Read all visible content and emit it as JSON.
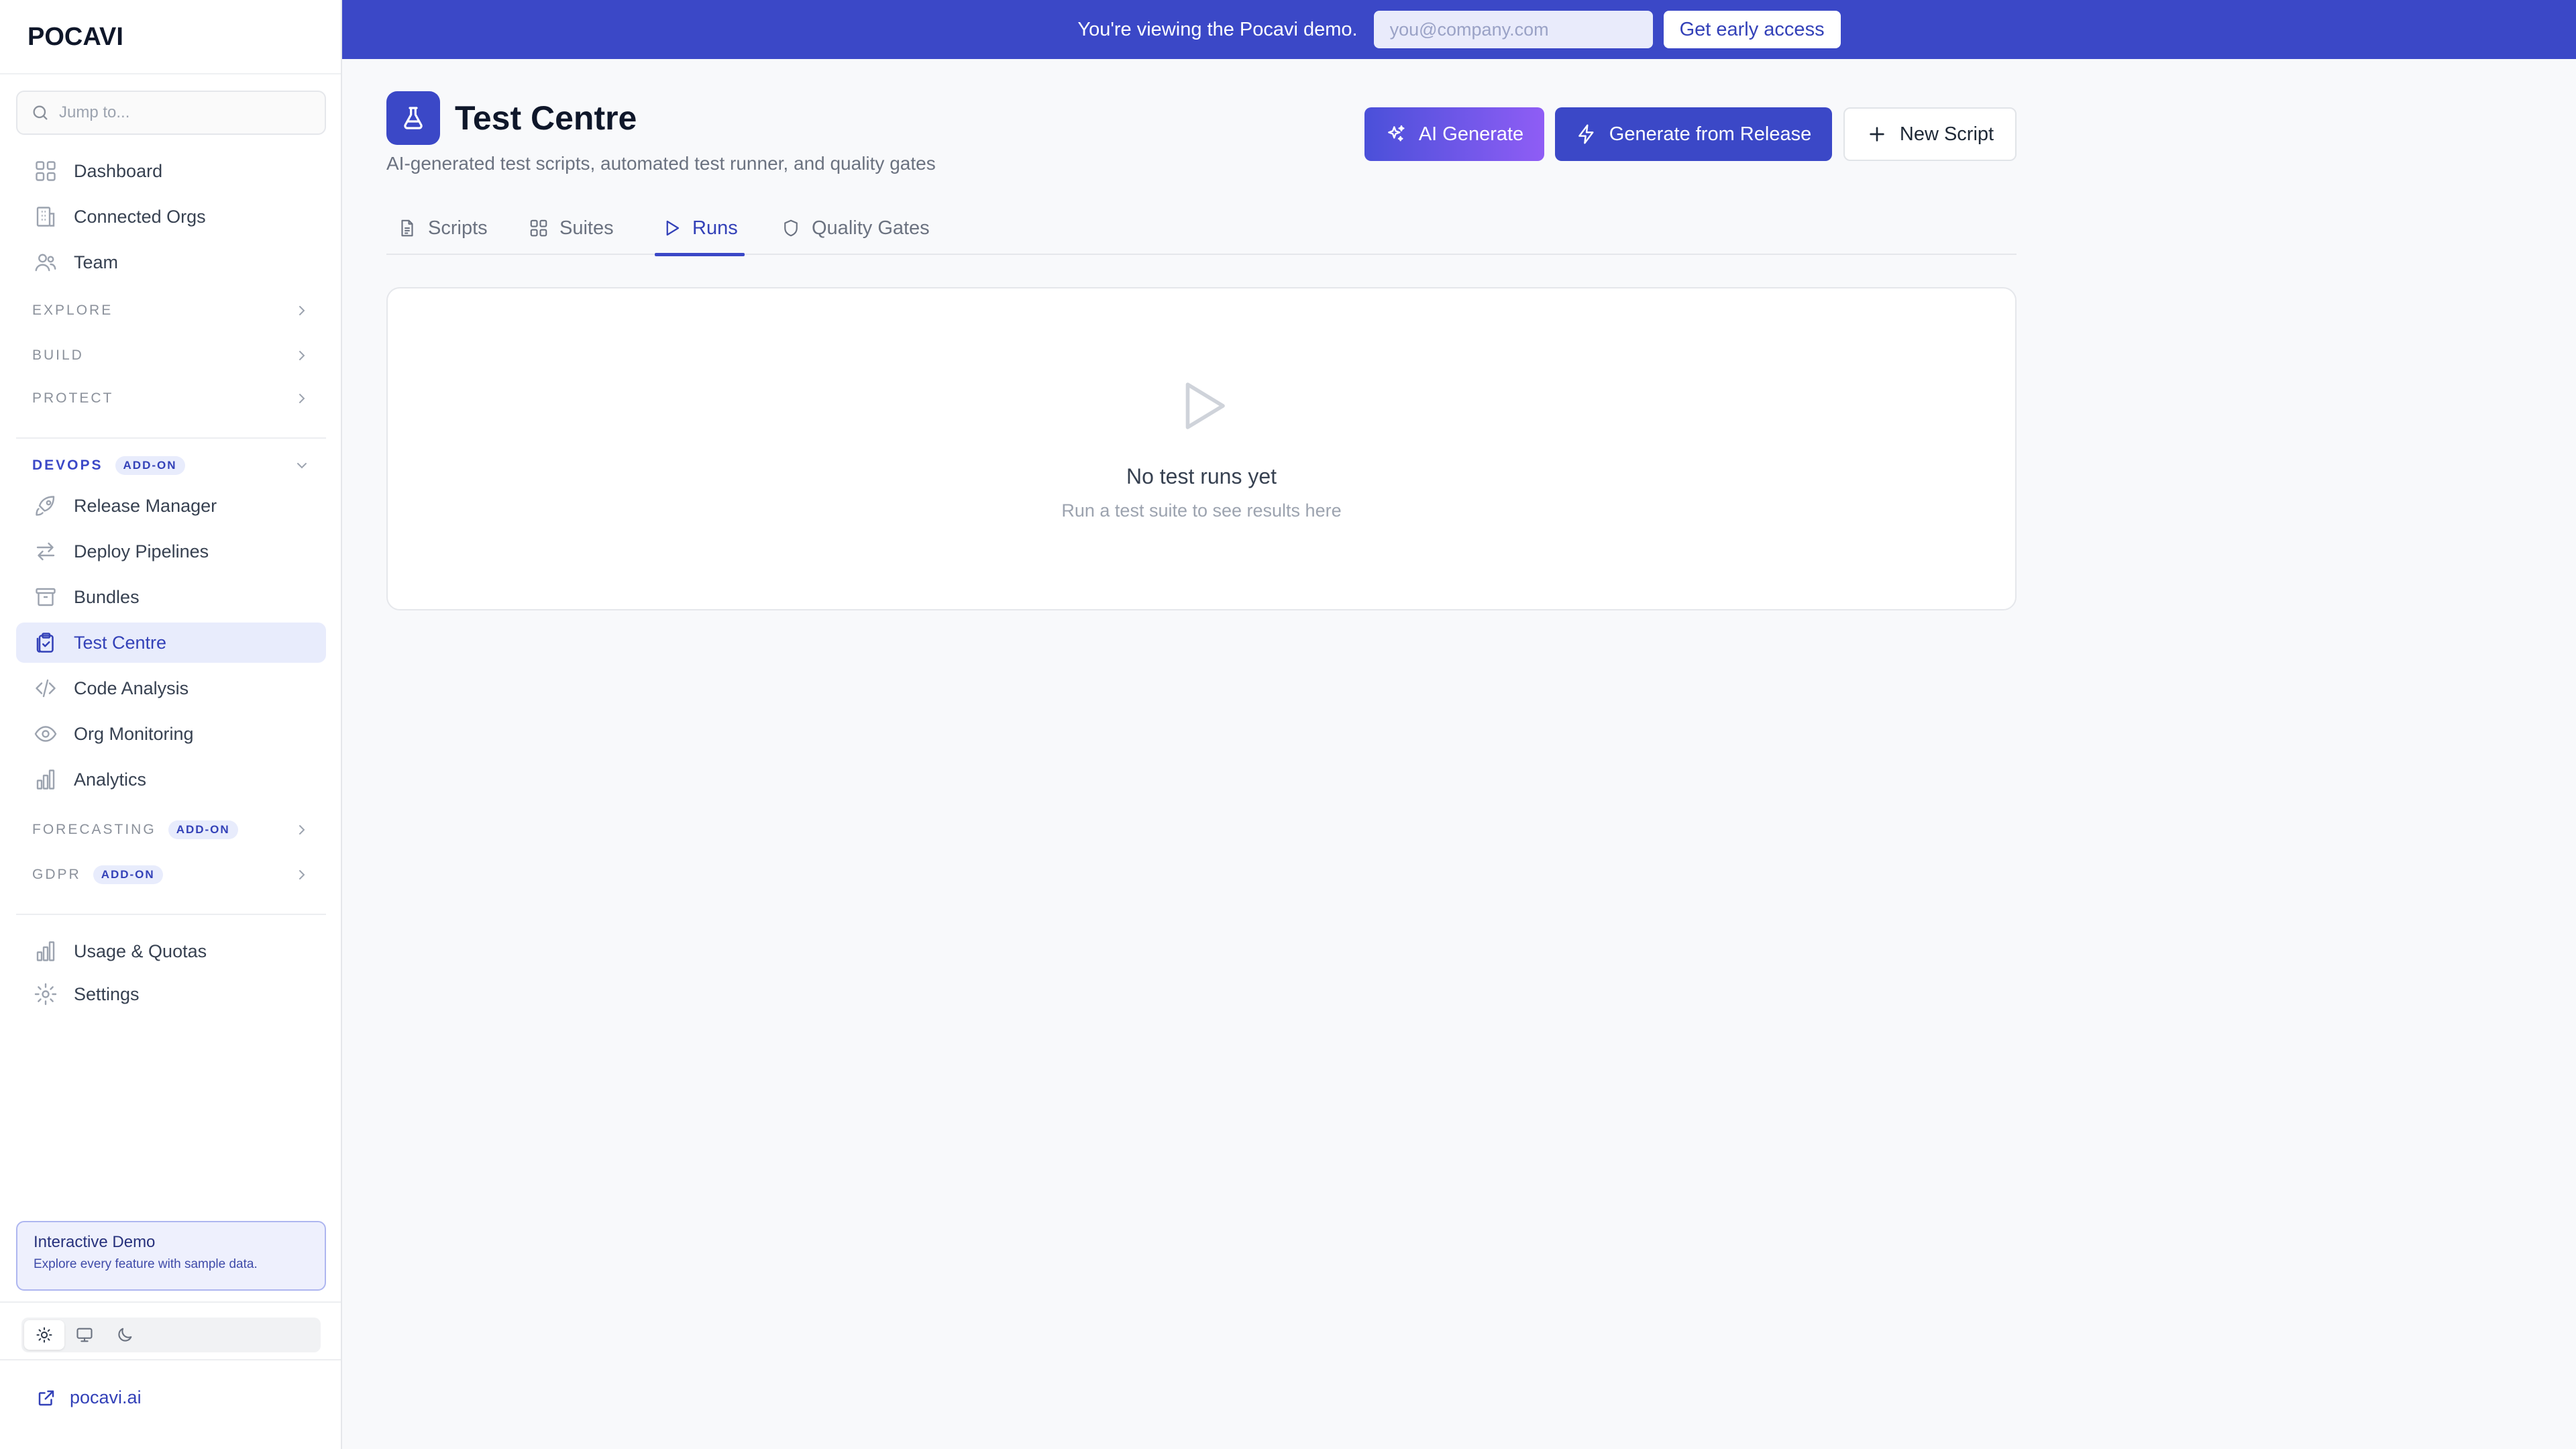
{
  "app": {
    "logo": "POCAVI",
    "search_placeholder": "Jump to..."
  },
  "sidebar": {
    "top_items": [
      {
        "label": "Dashboard",
        "icon": "grid-icon"
      },
      {
        "label": "Connected Orgs",
        "icon": "building-icon"
      },
      {
        "label": "Team",
        "icon": "users-icon"
      }
    ],
    "sections": {
      "explore": "EXPLORE",
      "build": "BUILD",
      "protect": "PROTECT",
      "devops": "DEVOPS",
      "devops_badge": "ADD-ON",
      "forecasting": "FORECASTING",
      "forecasting_badge": "ADD-ON",
      "gdpr": "GDPR",
      "gdpr_badge": "ADD-ON"
    },
    "devops_items": [
      {
        "label": "Release Manager",
        "icon": "rocket-icon"
      },
      {
        "label": "Deploy Pipelines",
        "icon": "arrows-left-right-icon"
      },
      {
        "label": "Bundles",
        "icon": "archive-icon"
      },
      {
        "label": "Test Centre",
        "icon": "clipboard-check-icon",
        "active": true
      },
      {
        "label": "Code Analysis",
        "icon": "code-icon"
      },
      {
        "label": "Org Monitoring",
        "icon": "eye-icon"
      },
      {
        "label": "Analytics",
        "icon": "bar-chart-icon"
      }
    ],
    "bottom_items": [
      {
        "label": "Usage & Quotas",
        "icon": "bar-chart-icon"
      },
      {
        "label": "Settings",
        "icon": "gear-icon"
      }
    ],
    "demo_card": {
      "title": "Interactive Demo",
      "subtitle": "Explore every feature with sample data."
    },
    "theme_options": [
      "sun-icon",
      "monitor-icon",
      "moon-icon"
    ],
    "theme_selected": "light",
    "external_link": "pocavi.ai"
  },
  "banner": {
    "message": "You're viewing the Pocavi demo.",
    "email_placeholder": "you@company.com",
    "cta": "Get early access"
  },
  "header": {
    "title": "Test Centre",
    "subtitle": "AI-generated test scripts, automated test runner, and quality gates",
    "buttons": {
      "ai_generate": "AI Generate",
      "generate_release": "Generate from Release",
      "new_script": "New Script"
    }
  },
  "tabs": [
    {
      "label": "Scripts",
      "icon": "file-text-icon"
    },
    {
      "label": "Suites",
      "icon": "grid-icon"
    },
    {
      "label": "Runs",
      "icon": "play-icon",
      "active": true
    },
    {
      "label": "Quality Gates",
      "icon": "shield-icon"
    }
  ],
  "empty_state": {
    "title": "No test runs yet",
    "subtitle": "Run a test suite to see results here"
  },
  "colors": {
    "accent": "#3b48c7",
    "accent_light": "#e8ecfc",
    "gradient_end": "#8f5df5",
    "text_muted": "#6b7280"
  }
}
